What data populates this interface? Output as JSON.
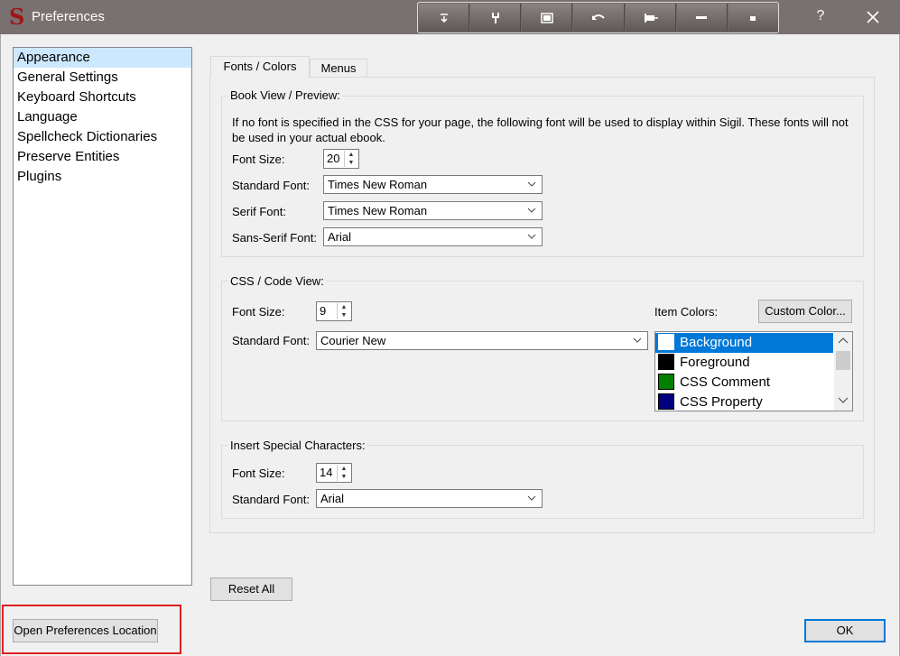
{
  "window": {
    "title": "Preferences",
    "app_icon": "sigil-s-icon",
    "help": "?"
  },
  "toolbar": {
    "icons": [
      "collapse-icon",
      "wrench-icon",
      "window-icon",
      "undo-icon",
      "pin-icon",
      "minus-icon",
      "minimize-icon"
    ]
  },
  "sidebar": {
    "items": [
      {
        "label": "Appearance",
        "selected": true
      },
      {
        "label": "General Settings"
      },
      {
        "label": "Keyboard Shortcuts"
      },
      {
        "label": "Language"
      },
      {
        "label": "Spellcheck Dictionaries"
      },
      {
        "label": "Preserve Entities"
      },
      {
        "label": "Plugins"
      }
    ]
  },
  "tabs": [
    {
      "label": "Fonts / Colors",
      "active": true
    },
    {
      "label": "Menus"
    }
  ],
  "book_view": {
    "title": "Book View / Preview:",
    "description": "If no font is specified in the CSS for your page, the following font will be used to display within Sigil. These fonts will not be used in your actual ebook.",
    "font_size_label": "Font Size:",
    "font_size": "20",
    "standard_font_label": "Standard Font:",
    "standard_font": "Times New Roman",
    "serif_font_label": "Serif Font:",
    "serif_font": "Times New Roman",
    "sans_font_label": "Sans-Serif Font:",
    "sans_font": "Arial"
  },
  "css_view": {
    "title": "CSS / Code View:",
    "font_size_label": "Font Size:",
    "font_size": "9",
    "standard_font_label": "Standard Font:",
    "standard_font": "Courier New",
    "item_colors_label": "Item Colors:",
    "custom_color_button": "Custom Color...",
    "colors": [
      {
        "label": "Background",
        "color": "#ffffff",
        "selected": true
      },
      {
        "label": "Foreground",
        "color": "#000000"
      },
      {
        "label": "CSS Comment",
        "color": "#008000"
      },
      {
        "label": "CSS Property",
        "color": "#000080"
      }
    ]
  },
  "special_chars": {
    "title": "Insert Special Characters:",
    "font_size_label": "Font Size:",
    "font_size": "14",
    "standard_font_label": "Standard Font:",
    "standard_font": "Arial"
  },
  "buttons": {
    "reset_all": "Reset All",
    "open_location": "Open Preferences Location",
    "ok": "OK"
  }
}
